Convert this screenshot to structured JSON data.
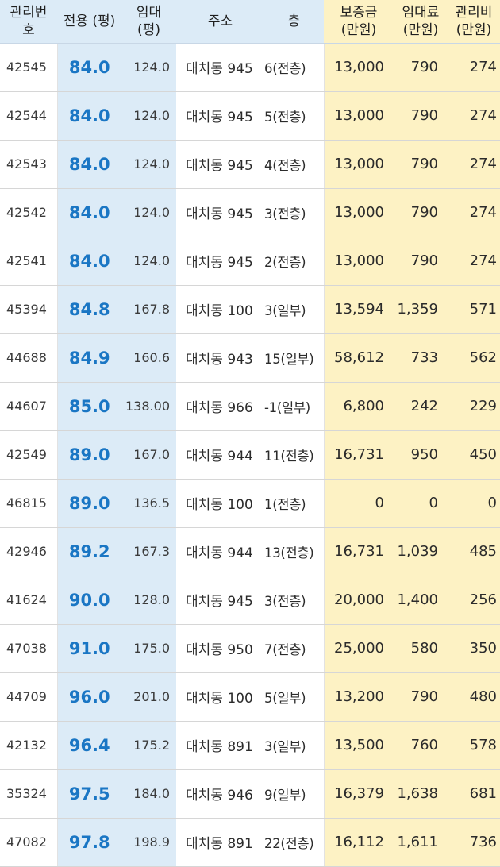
{
  "headers": {
    "id": [
      "관리번",
      "호"
    ],
    "area": "전용 (평)",
    "lease": [
      "임대",
      "(평)"
    ],
    "address": "주소",
    "floor": "층",
    "deposit": [
      "보증금",
      "(만원)"
    ],
    "rent": [
      "임대료",
      "(만원)"
    ],
    "mgmt": [
      "관리비",
      "(만원)"
    ]
  },
  "colors": {
    "header_blue": "#dcebf7",
    "header_yellow": "#fdf2c4",
    "area_text": "#1a76c4"
  },
  "rows": [
    {
      "id": "42545",
      "area": "84.0",
      "lease": "124.0",
      "address": "대치동 945",
      "floor": "6(전층)",
      "deposit": "13,000",
      "rent": "790",
      "mgmt": "274"
    },
    {
      "id": "42544",
      "area": "84.0",
      "lease": "124.0",
      "address": "대치동 945",
      "floor": "5(전층)",
      "deposit": "13,000",
      "rent": "790",
      "mgmt": "274"
    },
    {
      "id": "42543",
      "area": "84.0",
      "lease": "124.0",
      "address": "대치동 945",
      "floor": "4(전층)",
      "deposit": "13,000",
      "rent": "790",
      "mgmt": "274"
    },
    {
      "id": "42542",
      "area": "84.0",
      "lease": "124.0",
      "address": "대치동 945",
      "floor": "3(전층)",
      "deposit": "13,000",
      "rent": "790",
      "mgmt": "274"
    },
    {
      "id": "42541",
      "area": "84.0",
      "lease": "124.0",
      "address": "대치동 945",
      "floor": "2(전층)",
      "deposit": "13,000",
      "rent": "790",
      "mgmt": "274"
    },
    {
      "id": "45394",
      "area": "84.8",
      "lease": "167.8",
      "address": "대치동 100",
      "floor": "3(일부)",
      "deposit": "13,594",
      "rent": "1,359",
      "mgmt": "571"
    },
    {
      "id": "44688",
      "area": "84.9",
      "lease": "160.6",
      "address": "대치동 943",
      "floor": "15(일부)",
      "deposit": "58,612",
      "rent": "733",
      "mgmt": "562"
    },
    {
      "id": "44607",
      "area": "85.0",
      "lease": "138.00",
      "address": "대치동 966",
      "floor": "-1(일부)",
      "deposit": "6,800",
      "rent": "242",
      "mgmt": "229"
    },
    {
      "id": "42549",
      "area": "89.0",
      "lease": "167.0",
      "address": "대치동 944",
      "floor": "11(전층)",
      "deposit": "16,731",
      "rent": "950",
      "mgmt": "450"
    },
    {
      "id": "46815",
      "area": "89.0",
      "lease": "136.5",
      "address": "대치동 100",
      "floor": "1(전층)",
      "deposit": "0",
      "rent": "0",
      "mgmt": "0"
    },
    {
      "id": "42946",
      "area": "89.2",
      "lease": "167.3",
      "address": "대치동 944",
      "floor": "13(전층)",
      "deposit": "16,731",
      "rent": "1,039",
      "mgmt": "485"
    },
    {
      "id": "41624",
      "area": "90.0",
      "lease": "128.0",
      "address": "대치동 945",
      "floor": "3(전층)",
      "deposit": "20,000",
      "rent": "1,400",
      "mgmt": "256"
    },
    {
      "id": "47038",
      "area": "91.0",
      "lease": "175.0",
      "address": "대치동 950",
      "floor": "7(전층)",
      "deposit": "25,000",
      "rent": "580",
      "mgmt": "350"
    },
    {
      "id": "44709",
      "area": "96.0",
      "lease": "201.0",
      "address": "대치동 100",
      "floor": "5(일부)",
      "deposit": "13,200",
      "rent": "790",
      "mgmt": "480"
    },
    {
      "id": "42132",
      "area": "96.4",
      "lease": "175.2",
      "address": "대치동 891",
      "floor": "3(일부)",
      "deposit": "13,500",
      "rent": "760",
      "mgmt": "578"
    },
    {
      "id": "35324",
      "area": "97.5",
      "lease": "184.0",
      "address": "대치동 946",
      "floor": "9(일부)",
      "deposit": "16,379",
      "rent": "1,638",
      "mgmt": "681"
    },
    {
      "id": "47082",
      "area": "97.8",
      "lease": "198.9",
      "address": "대치동 891",
      "floor": "22(전층)",
      "deposit": "16,112",
      "rent": "1,611",
      "mgmt": "736"
    }
  ]
}
